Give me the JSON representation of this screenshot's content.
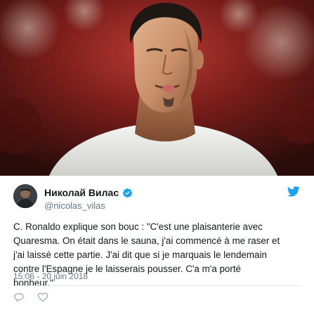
{
  "tweet": {
    "display_name": "Николай Вилас",
    "handle": "@nicolas_vilas",
    "text": "C. Ronaldo explique son bouc : \"C'est une plaisanterie avec\nQuaresma. On était dans le sauna, j'ai commencé à me raser et\nj'ai laissé cette partie. J'ai dit que si je marquais le lendemain\ncontre l'Espagne je le laisserais pousser. C'a m'a porté\nbonheur.\"",
    "timestamp": "15:06 - 20 juin 2018"
  },
  "colors": {
    "text_primary": "#14171a",
    "text_secondary": "#657786",
    "twitter_blue": "#1da1f2",
    "divider": "#e1e8ed"
  },
  "icons": [
    "verified-badge-icon",
    "twitter-bird-icon"
  ]
}
